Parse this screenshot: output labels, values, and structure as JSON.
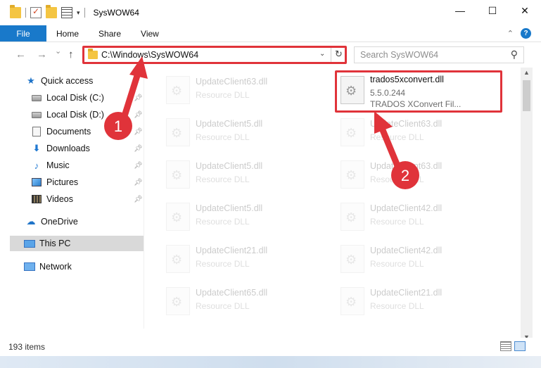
{
  "window": {
    "title": "SysWOW64",
    "controls": {
      "minimize": "—",
      "maximize": "☐",
      "close": "✕"
    }
  },
  "ribbon": {
    "tabs": [
      "File",
      "Home",
      "Share",
      "View"
    ],
    "collapse_icon": "chevron-up-icon",
    "help_label": "?"
  },
  "navigation": {
    "back": "←",
    "forward": "→",
    "recent": "⌄",
    "up": "↑",
    "address_path": "C:\\Windows\\SysWOW64",
    "search_placeholder": "Search SysWOW64"
  },
  "sidebar": {
    "items": [
      {
        "label": "Quick access",
        "icon": "star-icon"
      },
      {
        "label": "Local Disk (C:)",
        "icon": "drive-icon",
        "pinned": true
      },
      {
        "label": "Local Disk (D:)",
        "icon": "drive-icon",
        "pinned": true
      },
      {
        "label": "Documents",
        "icon": "documents-icon",
        "pinned": true
      },
      {
        "label": "Downloads",
        "icon": "downloads-icon",
        "pinned": true
      },
      {
        "label": "Music",
        "icon": "music-icon",
        "pinned": true
      },
      {
        "label": "Pictures",
        "icon": "pictures-icon",
        "pinned": true
      },
      {
        "label": "Videos",
        "icon": "videos-icon",
        "pinned": true
      },
      {
        "label": "OneDrive",
        "icon": "onedrive-icon"
      },
      {
        "label": "This PC",
        "icon": "this-pc-icon",
        "selected": true
      },
      {
        "label": "Network",
        "icon": "network-icon"
      }
    ]
  },
  "files": [
    {
      "name": "UpdateClient63.dll",
      "type": "Resource DLL",
      "faded": true
    },
    {
      "name": "trados5xconvert.dll",
      "version": "5.5.0.244",
      "desc": "TRADOS XConvert Fil...",
      "faded": false,
      "highlighted": true
    },
    {
      "name": "UpdateClient5.dll",
      "type": "Resource DLL",
      "faded": true
    },
    {
      "name": "UpdateClient63.dll",
      "type": "Resource DLL",
      "faded": true
    },
    {
      "name": "UpdateClient5.dll",
      "type": "Resource DLL",
      "faded": true
    },
    {
      "name": "UpdateClient63.dll",
      "type": "Resource DLL",
      "faded": true
    },
    {
      "name": "UpdateClient5.dll",
      "type": "Resource DLL",
      "faded": true
    },
    {
      "name": "UpdateClient42.dll",
      "type": "Resource DLL",
      "faded": true
    },
    {
      "name": "UpdateClient21.dll",
      "type": "Resource DLL",
      "faded": true
    },
    {
      "name": "UpdateClient42.dll",
      "type": "Resource DLL",
      "faded": true
    },
    {
      "name": "UpdateClient65.dll",
      "type": "Resource DLL",
      "faded": true
    },
    {
      "name": "UpdateClient21.dll",
      "type": "Resource DLL",
      "faded": true
    }
  ],
  "status": {
    "item_count": "193 items"
  },
  "annotations": {
    "step1": "1",
    "step2": "2",
    "highlight_color": "#e0333a"
  },
  "colors": {
    "accent": "#1979ca",
    "annotation_red": "#e0333a"
  }
}
